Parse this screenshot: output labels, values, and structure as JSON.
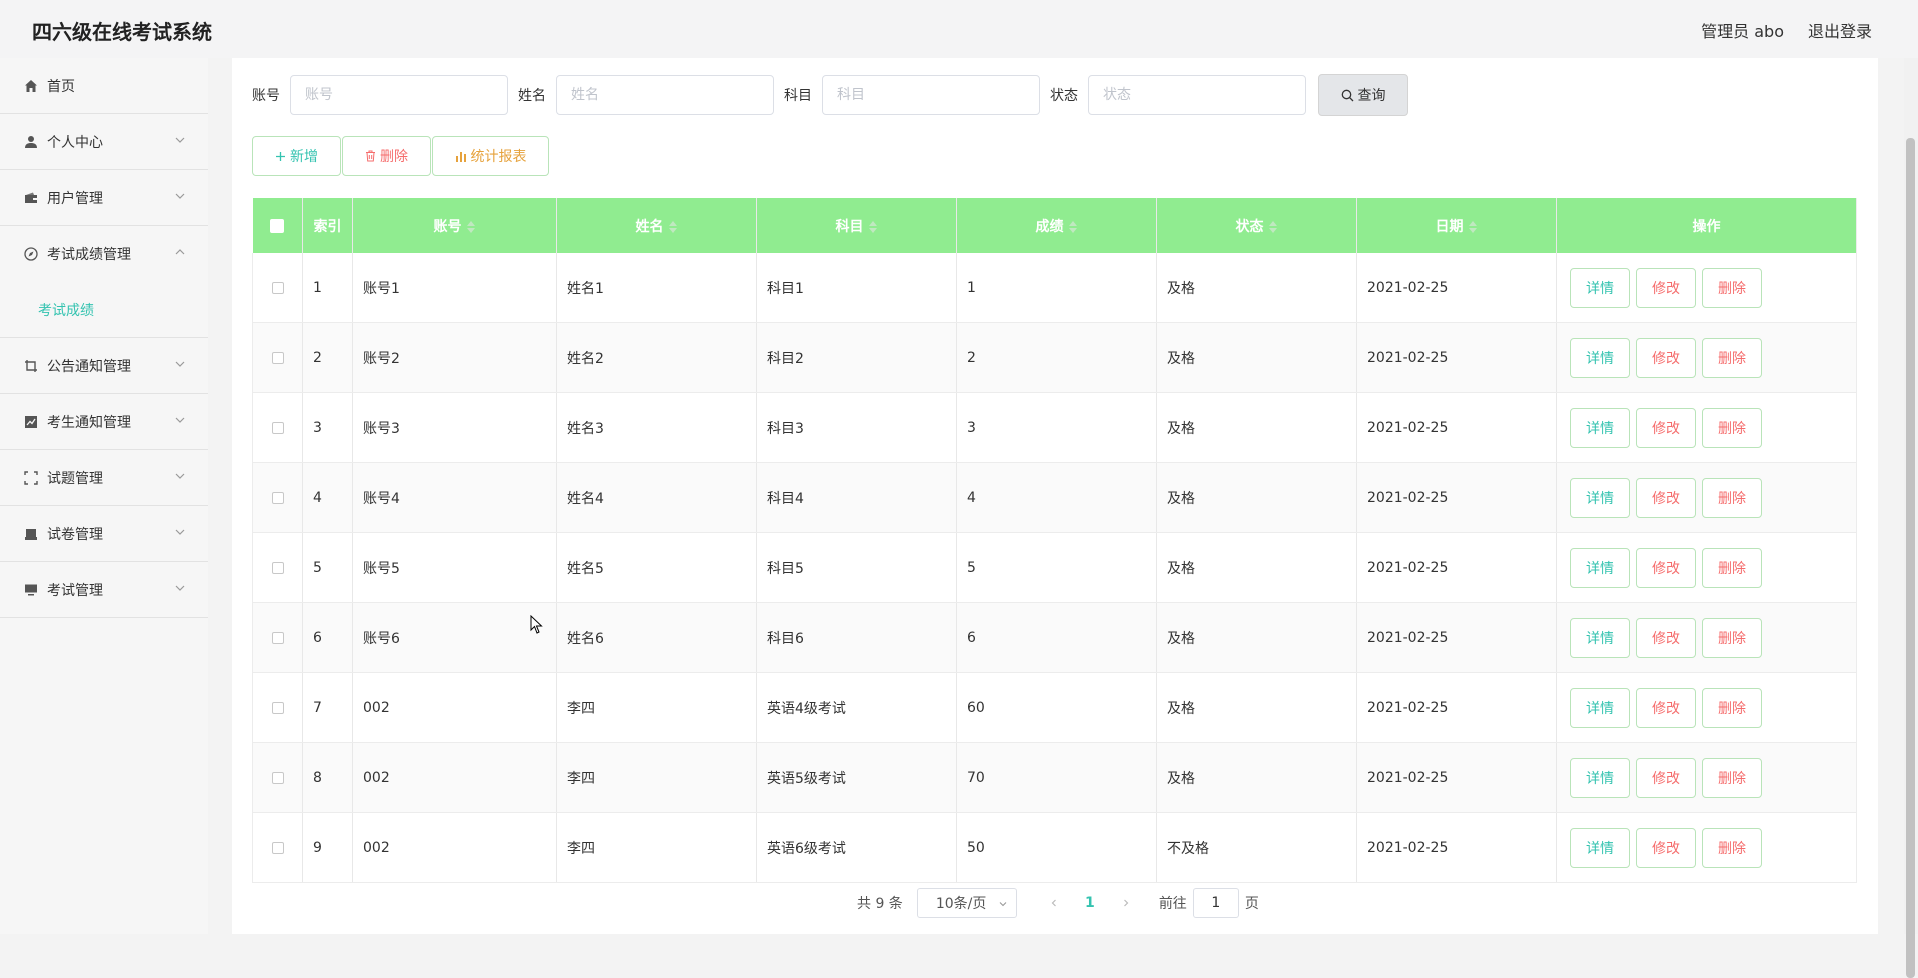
{
  "header": {
    "app_title": "四六级在线考试系统",
    "admin_label": "管理员 abo",
    "logout_label": "退出登录"
  },
  "sidebar": {
    "items": [
      {
        "label": "首页",
        "icon": "home-icon"
      },
      {
        "label": "个人中心",
        "icon": "user-icon"
      },
      {
        "label": "用户管理",
        "icon": "wallet-icon"
      },
      {
        "label": "考试成绩管理",
        "icon": "compass-icon",
        "expanded": true
      },
      {
        "label": "公告通知管理",
        "icon": "crop-icon"
      },
      {
        "label": "考生通知管理",
        "icon": "chart-icon"
      },
      {
        "label": "试题管理",
        "icon": "fullscreen-icon"
      },
      {
        "label": "试卷管理",
        "icon": "printer-icon"
      },
      {
        "label": "考试管理",
        "icon": "monitor-icon"
      }
    ],
    "subitem_active": "考试成绩"
  },
  "search": {
    "account_label": "账号",
    "account_placeholder": "账号",
    "name_label": "姓名",
    "name_placeholder": "姓名",
    "subject_label": "科目",
    "subject_placeholder": "科目",
    "status_label": "状态",
    "status_placeholder": "状态",
    "query_label": "查询"
  },
  "actions": {
    "add_label": "新增",
    "delete_label": "删除",
    "report_label": "统计报表"
  },
  "table": {
    "columns": [
      "索引",
      "账号",
      "姓名",
      "科目",
      "成绩",
      "状态",
      "日期",
      "操作"
    ],
    "rows": [
      {
        "index": "1",
        "account": "账号1",
        "name": "姓名1",
        "subject": "科目1",
        "score": "1",
        "status": "及格",
        "date": "2021-02-25"
      },
      {
        "index": "2",
        "account": "账号2",
        "name": "姓名2",
        "subject": "科目2",
        "score": "2",
        "status": "及格",
        "date": "2021-02-25"
      },
      {
        "index": "3",
        "account": "账号3",
        "name": "姓名3",
        "subject": "科目3",
        "score": "3",
        "status": "及格",
        "date": "2021-02-25"
      },
      {
        "index": "4",
        "account": "账号4",
        "name": "姓名4",
        "subject": "科目4",
        "score": "4",
        "status": "及格",
        "date": "2021-02-25"
      },
      {
        "index": "5",
        "account": "账号5",
        "name": "姓名5",
        "subject": "科目5",
        "score": "5",
        "status": "及格",
        "date": "2021-02-25"
      },
      {
        "index": "6",
        "account": "账号6",
        "name": "姓名6",
        "subject": "科目6",
        "score": "6",
        "status": "及格",
        "date": "2021-02-25"
      },
      {
        "index": "7",
        "account": "002",
        "name": "李四",
        "subject": "英语4级考试",
        "score": "60",
        "status": "及格",
        "date": "2021-02-25"
      },
      {
        "index": "8",
        "account": "002",
        "name": "李四",
        "subject": "英语5级考试",
        "score": "70",
        "status": "及格",
        "date": "2021-02-25"
      },
      {
        "index": "9",
        "account": "002",
        "name": "李四",
        "subject": "英语6级考试",
        "score": "50",
        "status": "不及格",
        "date": "2021-02-25"
      }
    ],
    "op_detail": "详情",
    "op_edit": "修改",
    "op_delete": "删除"
  },
  "pagination": {
    "total": "共 9 条",
    "page_size": "10条/页",
    "current_page": "1",
    "goto_label": "前往",
    "goto_value": "1",
    "page_suffix": "页"
  },
  "colors": {
    "header_green": "#90ec90",
    "accent_teal": "#34c3b0",
    "danger_red": "#f56c6c",
    "warning_orange": "#e6a23c"
  }
}
